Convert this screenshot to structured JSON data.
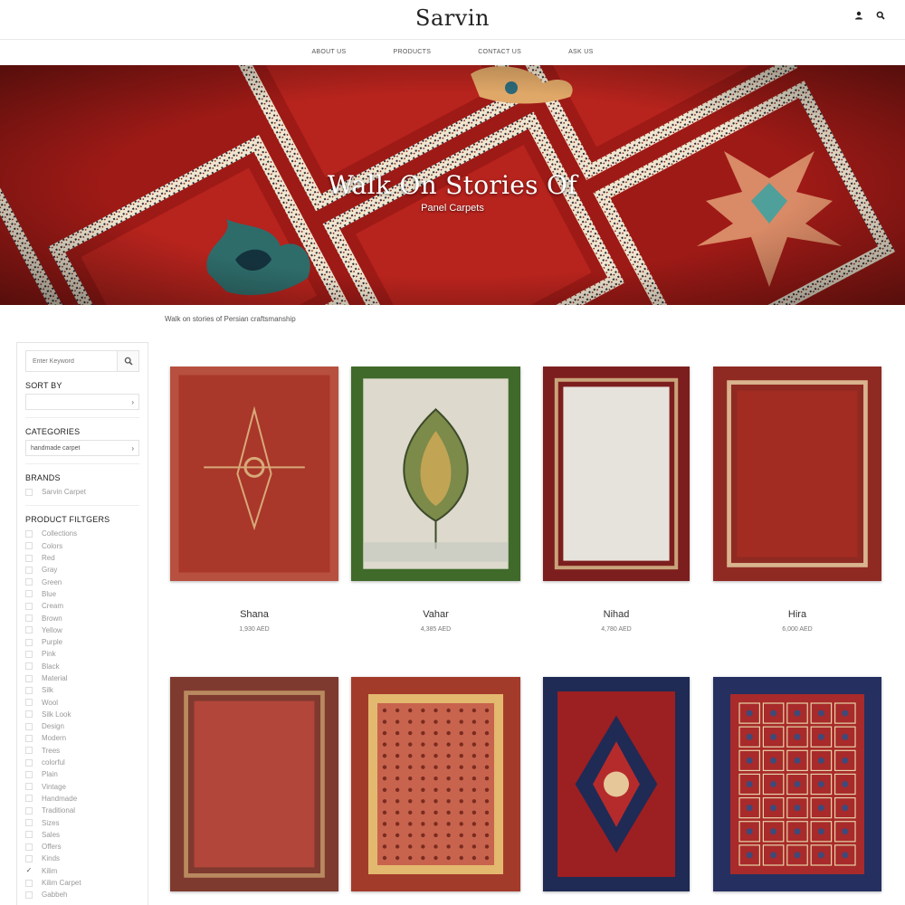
{
  "brand": {
    "logo": "Sarvin"
  },
  "nav": [
    "ABOUT US",
    "PRODUCTS",
    "CONTACT US",
    "ASK US"
  ],
  "hero": {
    "title": "Walk On Stories  Of",
    "subtitle": "Panel Carpets"
  },
  "tagline": "Walk on stories of Persian craftsmanship",
  "sidebar": {
    "search_placeholder": "Enter Keyword",
    "sort_heading": "SORT BY",
    "sort_value": "",
    "categories_heading": "CATEGORIES",
    "category_value": "handmade carpet",
    "brands_heading": "BRANDS",
    "brands": [
      {
        "label": "Sarvin Carpet",
        "checked": false
      }
    ],
    "filters_heading": "PRODUCT FILTGERS",
    "filters": [
      {
        "label": "Collections",
        "checked": false
      },
      {
        "label": "Colors",
        "checked": false
      },
      {
        "label": "Red",
        "checked": false
      },
      {
        "label": "Gray",
        "checked": false
      },
      {
        "label": "Green",
        "checked": false
      },
      {
        "label": "Blue",
        "checked": false
      },
      {
        "label": "Cream",
        "checked": false
      },
      {
        "label": "Brown",
        "checked": false
      },
      {
        "label": "Yellow",
        "checked": false
      },
      {
        "label": "Purple",
        "checked": false
      },
      {
        "label": "Pink",
        "checked": false
      },
      {
        "label": "Black",
        "checked": false
      },
      {
        "label": "Material",
        "checked": false
      },
      {
        "label": "Silk",
        "checked": false
      },
      {
        "label": "Wool",
        "checked": false
      },
      {
        "label": "Silk Look",
        "checked": false
      },
      {
        "label": "Design",
        "checked": false
      },
      {
        "label": "Modern",
        "checked": false
      },
      {
        "label": "Trees",
        "checked": false
      },
      {
        "label": "colorful",
        "checked": false
      },
      {
        "label": "Plain",
        "checked": false
      },
      {
        "label": "Vintage",
        "checked": false
      },
      {
        "label": "Handmade",
        "checked": false
      },
      {
        "label": "Traditional",
        "checked": false
      },
      {
        "label": "Sizes",
        "checked": false
      },
      {
        "label": "Sales",
        "checked": false
      },
      {
        "label": "Offers",
        "checked": false
      },
      {
        "label": "Kinds",
        "checked": false
      },
      {
        "label": "Kilim",
        "checked": true
      },
      {
        "label": "Kilim Carpet",
        "checked": false
      },
      {
        "label": "Gabbeh",
        "checked": false
      }
    ]
  },
  "products": [
    {
      "name": "Shana",
      "price": "1,930 AED",
      "style": "gabbeh-motif",
      "field": "#a9372a",
      "border": "#b8503f",
      "accent": "#d8a978"
    },
    {
      "name": "Vahar",
      "price": "4,385 AED",
      "style": "tree",
      "field": "#ddd9cc",
      "border": "#3f6a2a",
      "accent": "#7c8a4a"
    },
    {
      "name": "Nihad",
      "price": "4,780 AED",
      "style": "plain-center",
      "field": "#e6e3dc",
      "border": "#7d1e1e",
      "accent": "#c9a37a"
    },
    {
      "name": "Hira",
      "price": "6,000 AED",
      "style": "plain-center",
      "field": "#a32c22",
      "border": "#8f2a22",
      "accent": "#d9b48f"
    },
    {
      "name": "",
      "price": "",
      "style": "plain-center",
      "field": "#b2463a",
      "border": "#7f3a2f",
      "accent": "#b98a60"
    },
    {
      "name": "",
      "price": "",
      "style": "allover",
      "field": "#c8644e",
      "border": "#a33b2b",
      "accent": "#e3b86f"
    },
    {
      "name": "",
      "price": "",
      "style": "medallion",
      "field": "#9c1f22",
      "border": "#1f2a55",
      "accent": "#e5c79a"
    },
    {
      "name": "",
      "price": "",
      "style": "grid",
      "field": "#a82a2a",
      "border": "#253061",
      "accent": "#e7d3a6"
    }
  ]
}
